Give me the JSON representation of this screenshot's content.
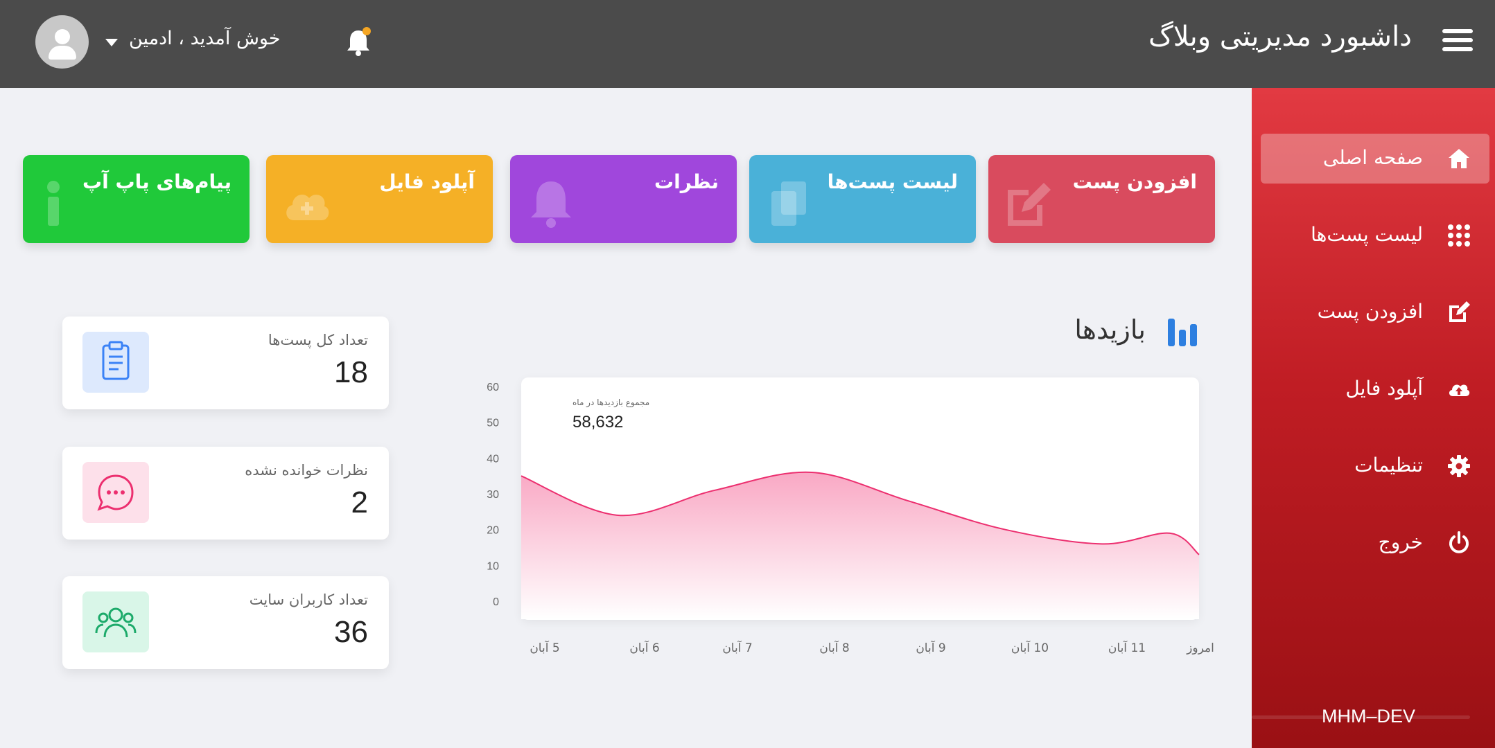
{
  "header": {
    "title": "داشبورد مدیریتی وبلاگ",
    "welcome": "خوش آمدید ، ادمین",
    "menu_icon": "hamburger-icon",
    "notification_icon": "bell-icon",
    "notification_dot_color": "#f5a623"
  },
  "sidebar": {
    "items": [
      {
        "label": "صفحه اصلی",
        "icon": "home-icon",
        "active": true
      },
      {
        "label": "لیست پست‌ها",
        "icon": "grid-icon"
      },
      {
        "label": "افزودن پست",
        "icon": "edit-icon"
      },
      {
        "label": "آپلود فایل",
        "icon": "cloud-upload-icon"
      },
      {
        "label": "تنظیمات",
        "icon": "gear-icon"
      },
      {
        "label": "خروج",
        "icon": "power-icon"
      }
    ],
    "brand": "MHM–DEV"
  },
  "tiles": [
    {
      "title": "افزودن پست",
      "color": "#d94b5e",
      "icon": "edit-icon"
    },
    {
      "title": "لیست پست‌ها",
      "color": "#4ab1d8",
      "icon": "documents-icon"
    },
    {
      "title": "نظرات",
      "color": "#a047dc",
      "icon": "bell-icon"
    },
    {
      "title": "آپلود فایل",
      "color": "#f5b026",
      "icon": "cloud-upload-icon"
    },
    {
      "title": "پیام‌های پاپ آپ",
      "color": "#20c93a",
      "icon": "info-icon"
    }
  ],
  "stats": [
    {
      "label": "تعداد کل پست‌ها",
      "value": "18",
      "icon": "clipboard-icon",
      "color": "#3b82f6",
      "bg": "#dde9fd"
    },
    {
      "label": "نظرات خوانده نشده",
      "value": "2",
      "icon": "chat-icon",
      "color": "#ec2f6f",
      "bg": "#fde0ea"
    },
    {
      "label": "تعداد کاربران سایت",
      "value": "36",
      "icon": "users-icon",
      "color": "#1caa6a",
      "bg": "#d9f6e8"
    }
  ],
  "chart": {
    "title": "بازیدها",
    "subtitle": "مجموع بازدیدها در ماه",
    "total": "58,632"
  },
  "chart_data": {
    "type": "area",
    "x": [
      "5 آبان",
      "6 آبان",
      "7 آبان",
      "8 آبان",
      "9 آبان",
      "10 آبان",
      "11 آبان",
      "امروز"
    ],
    "values": [
      35,
      24,
      31,
      36,
      28,
      20,
      16,
      19,
      13
    ],
    "x_points": [
      0,
      1,
      2,
      3,
      4,
      5,
      6,
      6.7,
      7
    ],
    "yticks": [
      60,
      50,
      40,
      30,
      20,
      10,
      0
    ],
    "ylim": [
      0,
      60
    ],
    "line_color": "#ec2f6f",
    "fill_color": "#f9a8c4"
  }
}
